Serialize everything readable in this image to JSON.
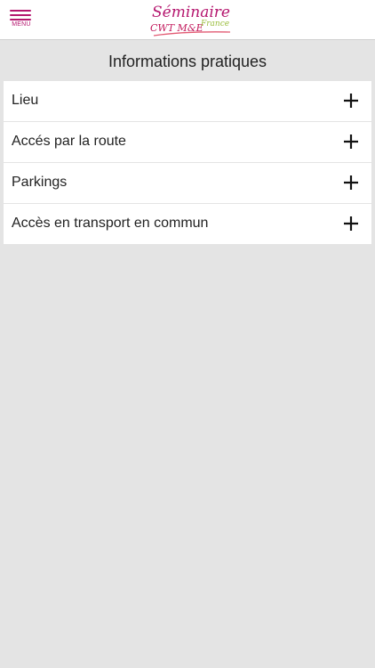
{
  "header": {
    "menu_label": "MENU",
    "menu_icon": "hamburger-icon",
    "logo": {
      "line1": "Séminaire",
      "line2": "CWT M&E",
      "line3": "France"
    },
    "accent_color": "#b5176f"
  },
  "page": {
    "title": "Informations pratiques"
  },
  "items": [
    {
      "label": "Lieu",
      "icon": "plus-icon"
    },
    {
      "label": "Accés par la route",
      "icon": "plus-icon"
    },
    {
      "label": "Parkings",
      "icon": "plus-icon"
    },
    {
      "label": "Accès en transport en commun",
      "icon": "plus-icon"
    }
  ]
}
